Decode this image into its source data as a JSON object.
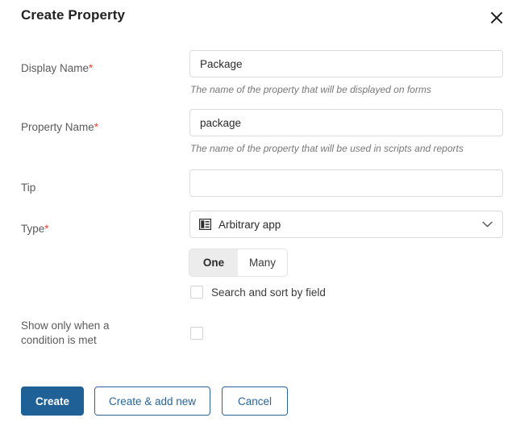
{
  "dialog": {
    "title": "Create Property",
    "close_icon": "close-icon"
  },
  "fields": {
    "display_name": {
      "label": "Display Name",
      "required_marker": "*",
      "value": "Package",
      "placeholder": "",
      "helper": "The name of the property that will be displayed on forms"
    },
    "property_name": {
      "label": "Property Name",
      "required_marker": "*",
      "value": "package",
      "placeholder": "",
      "helper": "The name of the property that will be used in scripts and reports"
    },
    "tip": {
      "label": "Tip",
      "value": "",
      "placeholder": ""
    },
    "type": {
      "label": "Type",
      "required_marker": "*",
      "value": "Arbitrary app",
      "value_icon": "app-card-icon",
      "chevron_icon": "chevron-down-icon"
    },
    "cardinality": {
      "options": [
        {
          "label": "One",
          "selected": true
        },
        {
          "label": "Many",
          "selected": false
        }
      ]
    },
    "search_sort": {
      "label": "Search and sort by field",
      "checked": false
    },
    "condition": {
      "label_line1": "Show only when a",
      "label_line2": "condition is met",
      "checked": false
    }
  },
  "footer": {
    "create_label": "Create",
    "create_add_new_label": "Create & add new",
    "cancel_label": "Cancel"
  },
  "colors": {
    "primary_blue": "#1f6096",
    "secondary_blue": "#2a6496",
    "required_red": "#e8452c",
    "label_gray": "#5b5b5b",
    "helper_gray": "#77787a",
    "border_gray": "#dcdcdc",
    "segment_active_bg": "#ececec"
  }
}
